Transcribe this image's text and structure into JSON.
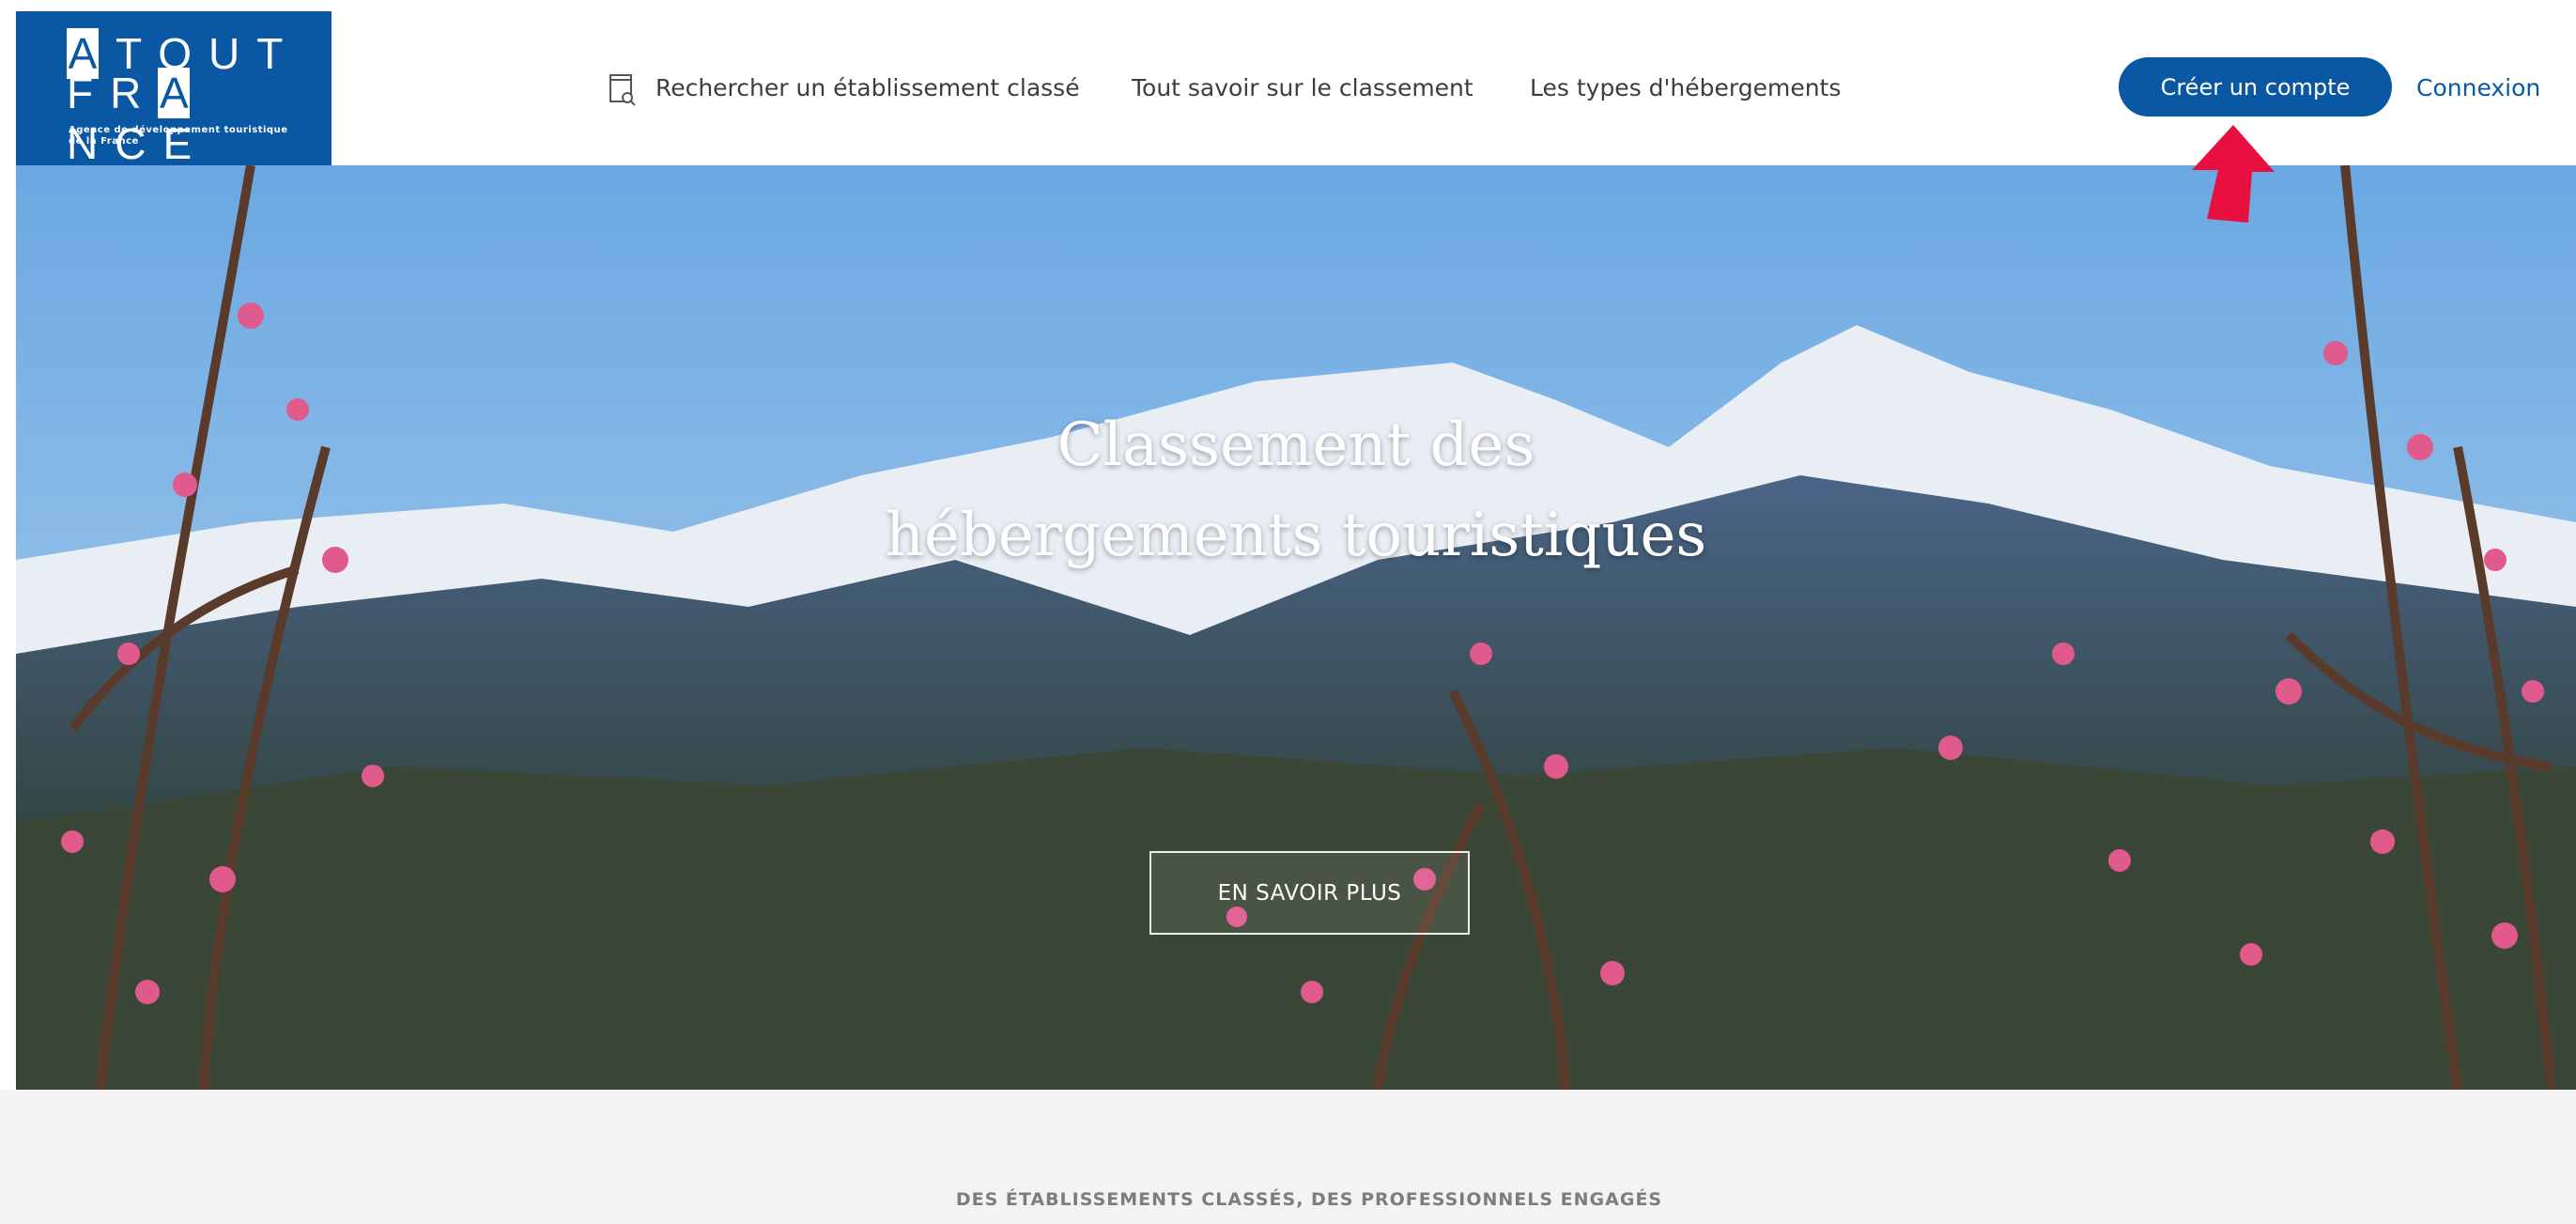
{
  "header": {
    "logo": {
      "line1": "ATOUT",
      "line2": "FRANCE",
      "tagline": "Agence de développement touristique de la France"
    },
    "nav": {
      "search_label": "Rechercher un établissement classé",
      "classement_label": "Tout savoir sur le classement",
      "types_label": "Les types d'hébergements"
    },
    "create_account_label": "Créer un compte",
    "login_label": "Connexion"
  },
  "hero": {
    "title_line1": "Classement des",
    "title_line2": "hébergements touristiques",
    "cta_label": "EN SAVOIR PLUS"
  },
  "section": {
    "tagline": "DES ÉTABLISSEMENTS CLASSÉS, DES PROFESSIONNELS ENGAGÉS"
  },
  "colors": {
    "brand_blue": "#0a58a3",
    "annotation_arrow": "#e8103f",
    "strip_bg": "#f3f3f3"
  },
  "icons": {
    "search_listing": "document-search-icon",
    "annotation": "red-arrow-icon"
  }
}
